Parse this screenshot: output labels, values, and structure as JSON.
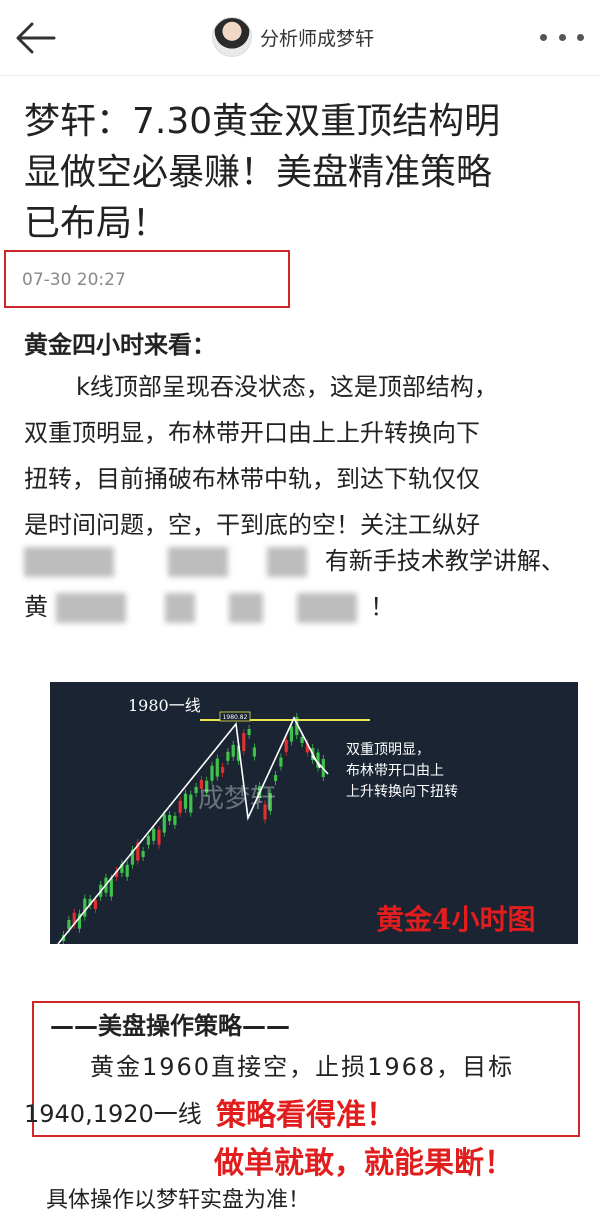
{
  "header": {
    "back_icon": "back-arrow-icon",
    "author_name": "分析师成梦轩",
    "more_icon": "more-dots-icon"
  },
  "article": {
    "title": "梦轩：7.30黄金双重顶结构明显做空必暴赚！美盘精准策略已布局！",
    "title_lines": [
      "梦轩：7.30黄金双重顶结构明",
      "显做空必暴赚！美盘精准策略",
      "已布局！"
    ],
    "date": "07-30 20:27",
    "subheading": "黄金四小时来看：",
    "paragraph_lines": [
      "k线顶部呈现吞没状态，这是顶部结构，",
      "双重顶明显，布林带开口由上上升转换向下",
      "扭转，目前捅破布林带中轨，到达下轨仅仅",
      "是时间问题，空，干到底的空！关注工纵好"
    ],
    "blurred_line_visible": "有新手技术教学讲解、",
    "blurred_line2_visible_start": "黄",
    "blurred_line2_visible_end": "！"
  },
  "chart_image": {
    "level_label": "1980一线",
    "peak_label": "1980.82",
    "note_lines": [
      "双重顶明显，",
      "布林带开口由上",
      "上升转换向下扭转"
    ],
    "watermark": "成梦轩",
    "caption": "黄金4小时图",
    "colors": {
      "background": "#1a2433",
      "bull": "#3ec24a",
      "bear": "#e03030",
      "level": "#e8e84a",
      "trend": "#ffffff",
      "caption": "#e11d1d"
    }
  },
  "strategy": {
    "title": "——美盘操作策略——",
    "line1": "黄金1960直接空，止损1968，目标",
    "line2": "1940,1920一线",
    "red_line1": "策略看得准！",
    "red_line2": "做单就敢，就能果断！",
    "footer": "具体操作以梦轩实盘为准！"
  }
}
